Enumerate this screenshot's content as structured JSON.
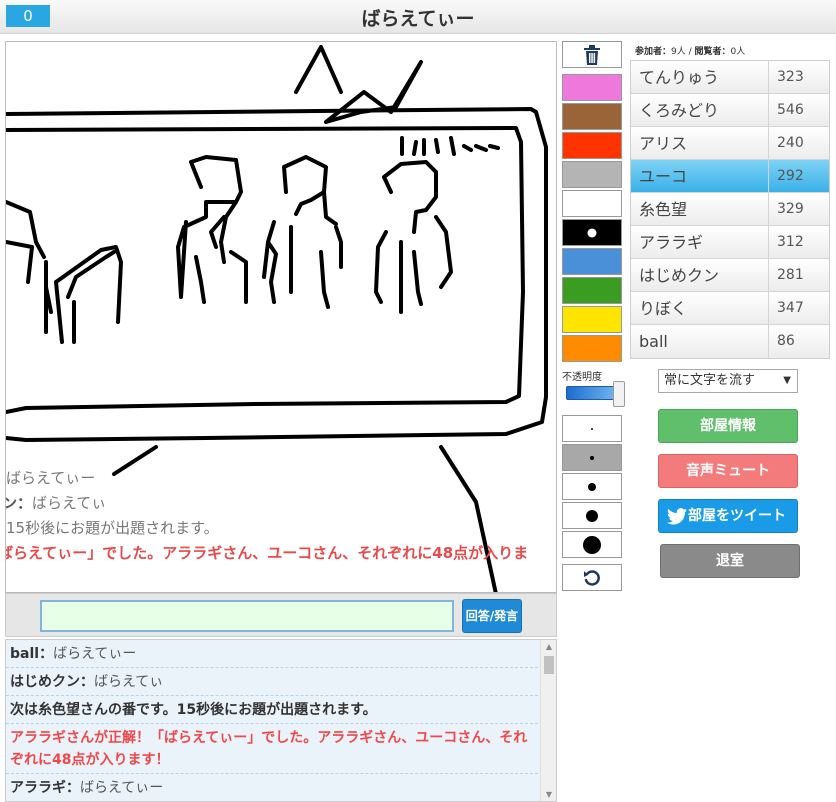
{
  "header": {
    "score": "0",
    "title": "ばらえてぃー"
  },
  "canvas_overlay": {
    "lines": [
      {
        "name": "",
        "text": "ばらえてぃー",
        "style": "normal"
      },
      {
        "name": "ン：",
        "text": "ばらえてぃ",
        "style": "normal"
      },
      {
        "name": "",
        "text": "15秒後にお題が出題されます。",
        "style": "normal"
      },
      {
        "name": "",
        "text": "ばらえてぃー」でした。アララギさん、ユーコさん、それぞれに48点が入りま",
        "style": "red"
      }
    ]
  },
  "answer": {
    "value": "",
    "button_label": "回答/発言"
  },
  "log": [
    {
      "name": "ball：",
      "text": "ばらえてぃー"
    },
    {
      "name": "はじめクン：",
      "text": "ばらえてぃ"
    },
    {
      "name": "",
      "text": "次は糸色望さんの番です。15秒後にお題が出題されます。"
    },
    {
      "name": "",
      "text": "アララギさんが正解！「ばらえてぃー」でした。アララギさん、ユーコさん、それぞれに48点が入ります！"
    },
    {
      "name": "アララギ：",
      "text": "ばらえてぃー"
    }
  ],
  "tools": {
    "colors": [
      "#ee78dc",
      "#9b6438",
      "#ff3300",
      "#b4b4b4",
      "#ffffff",
      "#000000",
      "#4a90d9",
      "#3a9c20",
      "#ffe400",
      "#ff8c00"
    ],
    "opacity_label": "不透明度",
    "opacity": 1.0,
    "brush_sizes": [
      2,
      4,
      8,
      12,
      18
    ]
  },
  "players_info": {
    "participants_label": "参加者：",
    "participants": "9人",
    "separator": " / ",
    "viewers_label": "閲覧者：",
    "viewers": "0人"
  },
  "players": [
    {
      "name": "てんりゅう",
      "score": "323",
      "active": false
    },
    {
      "name": "くろみどり",
      "score": "546",
      "active": false
    },
    {
      "name": "アリス",
      "score": "240",
      "active": false
    },
    {
      "name": "ユーコ",
      "score": "292",
      "active": true
    },
    {
      "name": "糸色望",
      "score": "329",
      "active": false
    },
    {
      "name": "アララギ",
      "score": "312",
      "active": false
    },
    {
      "name": "はじめクン",
      "score": "281",
      "active": false
    },
    {
      "name": "りぼく",
      "score": "347",
      "active": false
    },
    {
      "name": "ball",
      "score": "86",
      "active": false
    }
  ],
  "controls": {
    "mode_select": "常に文字を流す",
    "room_info": "部屋情報",
    "mute": "音声ミュート",
    "tweet": "部屋をツイート",
    "exit": "退室"
  }
}
